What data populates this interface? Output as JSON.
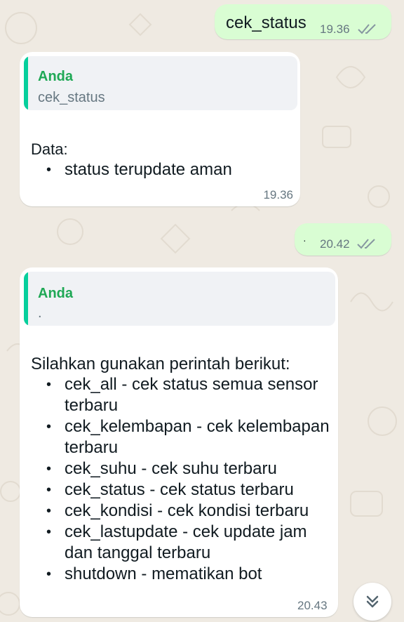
{
  "messages": [
    {
      "direction": "outgoing",
      "text": "cek_status",
      "time": "19.36",
      "status": "read"
    },
    {
      "direction": "incoming",
      "quote": {
        "name": "Anda",
        "text": "cek_status"
      },
      "heading": "Data:",
      "items": [
        "status terupdate aman"
      ],
      "time": "19.36"
    },
    {
      "direction": "outgoing",
      "text": "·",
      "time": "20.42",
      "status": "read"
    },
    {
      "direction": "incoming",
      "quote": {
        "name": "Anda",
        "text": "."
      },
      "heading": "Silahkan gunakan perintah berikut:",
      "items": [
        "cek_all - cek status semua sensor terbaru",
        "cek_kelembapan - cek kelembapan terbaru",
        "cek_suhu - cek suhu terbaru",
        "cek_status - cek status terbaru",
        "cek_kondisi - cek kondisi terbaru",
        "cek_lastupdate - cek update jam dan tanggal terbaru",
        "shutdown - mematikan bot"
      ],
      "time": "20.43"
    }
  ],
  "scroll_button": {
    "icon": "double-chevron-down-icon"
  },
  "colors": {
    "background": "#efeae2",
    "outgoing": "#d9fdd3",
    "incoming": "#ffffff",
    "quote_name": "#1fa855",
    "ticks": "#8696a0"
  }
}
